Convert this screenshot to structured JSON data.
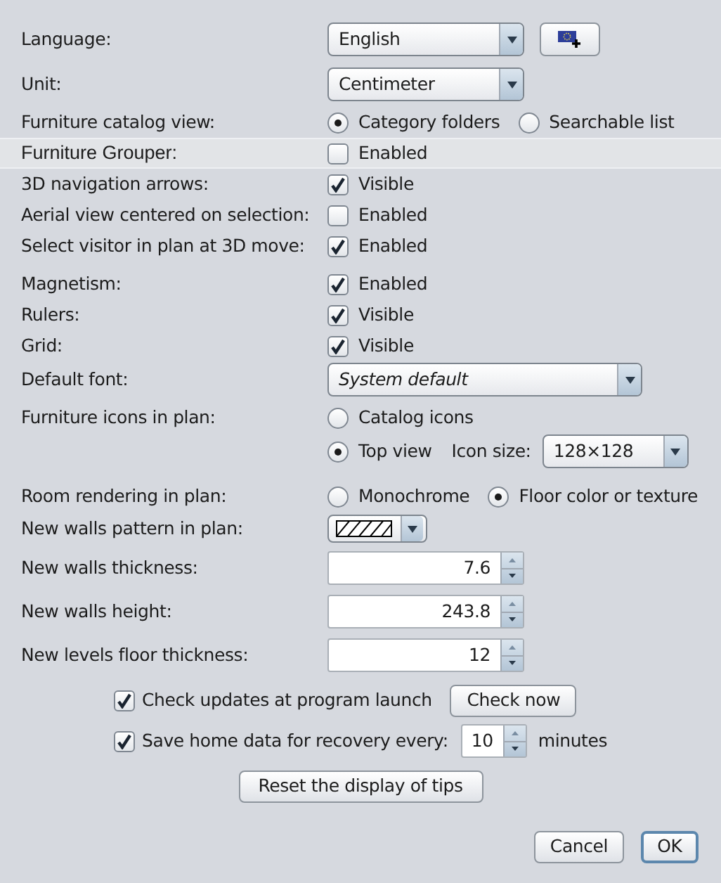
{
  "rows": [
    {
      "kind": "language",
      "label": "Language:",
      "value": "English"
    },
    {
      "kind": "combo",
      "label": "Unit:",
      "value": "Centimeter"
    },
    {
      "kind": "radios",
      "label": "Furniture catalog view:",
      "options": [
        {
          "label": "Category folders",
          "selected": true
        },
        {
          "label": "Searchable list",
          "selected": false
        }
      ]
    },
    {
      "kind": "checkbox",
      "label": "Furniture Grouper:",
      "text": "Enabled",
      "checked": false,
      "highlighted": true
    },
    {
      "kind": "checkbox",
      "label": "3D navigation arrows:",
      "text": "Visible",
      "checked": true,
      "highlighted": false
    },
    {
      "kind": "checkbox",
      "label": "Aerial view centered on selection:",
      "text": "Enabled",
      "checked": false,
      "highlighted": false
    },
    {
      "kind": "checkbox",
      "label": "Select visitor in plan at 3D move:",
      "text": "Enabled",
      "checked": true,
      "highlighted": false
    },
    {
      "kind": "checkbox",
      "label": "Magnetism:",
      "text": "Enabled",
      "checked": true,
      "highlighted": false
    },
    {
      "kind": "checkbox",
      "label": "Rulers:",
      "text": "Visible",
      "checked": true,
      "highlighted": false
    },
    {
      "kind": "checkbox",
      "label": "Grid:",
      "text": "Visible",
      "checked": true,
      "highlighted": false
    },
    {
      "kind": "font",
      "label": "Default font:",
      "value": "System default"
    },
    {
      "kind": "radios",
      "label": "Furniture icons in plan:",
      "options": [
        {
          "label": "Catalog icons",
          "selected": false
        }
      ]
    },
    {
      "kind": "iconsize",
      "options": [
        {
          "label": "Top view",
          "selected": true
        }
      ],
      "size_label": "Icon size:",
      "size_value": "128×128"
    },
    {
      "kind": "radios",
      "label": "Room rendering in plan:",
      "options": [
        {
          "label": "Monochrome",
          "selected": false
        },
        {
          "label": "Floor color or texture",
          "selected": true
        }
      ]
    },
    {
      "kind": "pattern",
      "label": "New walls pattern in plan:"
    },
    {
      "kind": "spinner",
      "label": "New walls thickness:",
      "value": "7.6"
    },
    {
      "kind": "spinner",
      "label": "New walls height:",
      "value": "243.8"
    },
    {
      "kind": "spinner",
      "label": "New levels floor thickness:",
      "value": "12"
    }
  ],
  "updates": {
    "checked": true,
    "label": "Check updates at program launch",
    "button": "Check now"
  },
  "recovery": {
    "checked": true,
    "label": "Save home data for recovery every:",
    "value": "10",
    "unit": "minutes"
  },
  "reset_button": "Reset the display of tips",
  "buttons": [
    {
      "label": "Cancel",
      "default": false
    },
    {
      "label": "OK",
      "default": true
    }
  ]
}
